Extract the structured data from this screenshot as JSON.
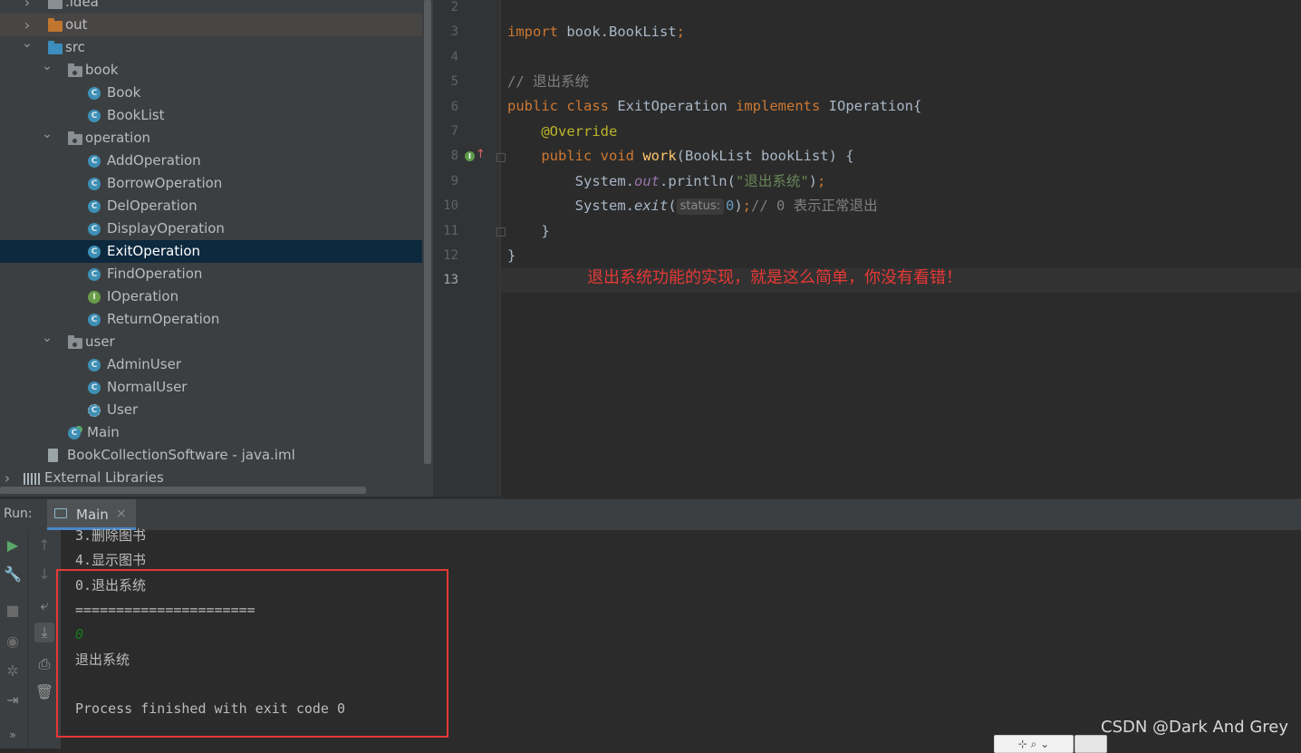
{
  "project_tree": {
    "items": [
      {
        "label": ".idea",
        "icon": "folder-gray-icon",
        "expanded": false
      },
      {
        "label": "out",
        "icon": "folder-orange-icon",
        "expanded": false
      },
      {
        "label": "src",
        "icon": "folder-blue-icon",
        "expanded": true
      },
      {
        "label": "book",
        "icon": "package-icon",
        "expanded": true
      },
      {
        "label": "Book",
        "icon": "class-icon"
      },
      {
        "label": "BookList",
        "icon": "class-icon"
      },
      {
        "label": "operation",
        "icon": "package-icon",
        "expanded": true
      },
      {
        "label": "AddOperation",
        "icon": "class-icon"
      },
      {
        "label": "BorrowOperation",
        "icon": "class-icon"
      },
      {
        "label": "DelOperation",
        "icon": "class-icon"
      },
      {
        "label": "DisplayOperation",
        "icon": "class-icon"
      },
      {
        "label": "ExitOperation",
        "icon": "class-icon",
        "selected": true
      },
      {
        "label": "FindOperation",
        "icon": "class-icon"
      },
      {
        "label": "IOperation",
        "icon": "interface-icon"
      },
      {
        "label": "ReturnOperation",
        "icon": "class-icon"
      },
      {
        "label": "user",
        "icon": "package-icon",
        "expanded": true
      },
      {
        "label": "AdminUser",
        "icon": "class-icon"
      },
      {
        "label": "NormalUser",
        "icon": "class-icon"
      },
      {
        "label": "User",
        "icon": "abstract-class-icon"
      },
      {
        "label": "Main",
        "icon": "main-class-icon"
      },
      {
        "label": "BookCollectionSoftware - java.iml",
        "icon": "iml-file-icon"
      },
      {
        "label": "External Libraries",
        "icon": "libraries-icon",
        "expanded": false
      }
    ],
    "icon_letters": {
      "class": "C",
      "interface": "I"
    }
  },
  "editor": {
    "line_numbers": [
      "2",
      "3",
      "4",
      "5",
      "6",
      "7",
      "8",
      "9",
      "10",
      "11",
      "12",
      "13"
    ],
    "current_line": "13",
    "code": {
      "l3_kw": "import",
      "l3_rest": " book.BookList",
      "l3_semi": ";",
      "l5_comment": "// 退出系统",
      "l6_kw1": "public",
      "l6_kw2": "class",
      "l6_name": " ExitOperation ",
      "l6_kw3": "implements",
      "l6_rest": " IOperation{",
      "l7_annotation": "@Override",
      "l8_kw1": "public",
      "l8_kw2": "void",
      "l8_fn": "work",
      "l8_rest": "(BookList bookList) {",
      "l9_a": "System.",
      "l9_field": "out",
      "l9_b": ".println(",
      "l9_str": "\"退出系统\"",
      "l9_c": ")",
      "l9_semi": ";",
      "l10_a": "System.",
      "l10_method": "exit",
      "l10_b": "(",
      "l10_hint": "status:",
      "l10_num": "0",
      "l10_c": ")",
      "l10_semi": ";",
      "l10_comment": "// 0 表示正常退出",
      "l11": "}",
      "l12": "}"
    },
    "annotation": "退出系统功能的实现，就是这么简单，你没有看错！"
  },
  "run_panel": {
    "label": "Run:",
    "tab_label": "Main",
    "tab_close": "×",
    "output": [
      {
        "text": "3.删除图书",
        "style": "normal"
      },
      {
        "text": "4.显示图书",
        "style": "normal"
      },
      {
        "text": "0.退出系统",
        "style": "normal"
      },
      {
        "text": "======================",
        "style": "normal"
      },
      {
        "text": "0",
        "style": "input"
      },
      {
        "text": "退出系统",
        "style": "normal"
      },
      {
        "text": "",
        "style": "normal"
      },
      {
        "text": "Process finished with exit code 0",
        "style": "normal"
      }
    ]
  },
  "watermark": "CSDN @Dark And Grey",
  "colors": {
    "accent_blue": "#4a88c7",
    "selection": "#0d293e",
    "highlight_red": "#e53935",
    "keyword": "#cc7832",
    "string": "#6a8759"
  }
}
